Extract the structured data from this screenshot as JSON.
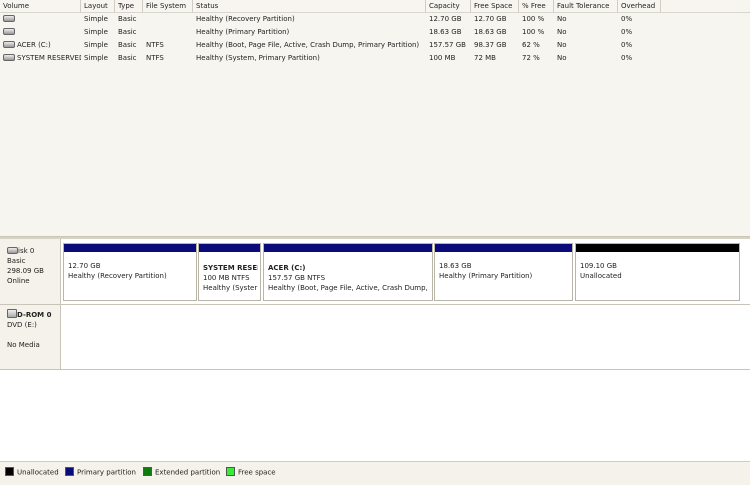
{
  "columns": [
    "Volume",
    "Layout",
    "Type",
    "File System",
    "Status",
    "Capacity",
    "Free Space",
    "% Free",
    "Fault Tolerance",
    "Overhead"
  ],
  "volumes": [
    {
      "volume": "",
      "layout": "Simple",
      "type": "Basic",
      "fs": "",
      "status": "Healthy (Recovery Partition)",
      "capacity": "12.70 GB",
      "free": "12.70 GB",
      "pct": "100 %",
      "fault": "No",
      "overhead": "0%"
    },
    {
      "volume": "",
      "layout": "Simple",
      "type": "Basic",
      "fs": "",
      "status": "Healthy (Primary Partition)",
      "capacity": "18.63 GB",
      "free": "18.63 GB",
      "pct": "100 %",
      "fault": "No",
      "overhead": "0%"
    },
    {
      "volume": "ACER (C:)",
      "layout": "Simple",
      "type": "Basic",
      "fs": "NTFS",
      "status": "Healthy (Boot, Page File, Active, Crash Dump, Primary Partition)",
      "capacity": "157.57 GB",
      "free": "98.37 GB",
      "pct": "62 %",
      "fault": "No",
      "overhead": "0%"
    },
    {
      "volume": "SYSTEM RESERVED",
      "layout": "Simple",
      "type": "Basic",
      "fs": "NTFS",
      "status": "Healthy (System, Primary Partition)",
      "capacity": "100 MB",
      "free": "72 MB",
      "pct": "72 %",
      "fault": "No",
      "overhead": "0%"
    }
  ],
  "disk0": {
    "name": "isk 0",
    "type": "Basic",
    "size": "298.09 GB",
    "status": "Online",
    "partitions": [
      {
        "title": "",
        "size": "12.70 GB",
        "status": "Healthy (Recovery Partition)"
      },
      {
        "title": "SYSTEM RESERV",
        "size": "100 MB NTFS",
        "status": "Healthy (Syster"
      },
      {
        "title": "ACER  (C:)",
        "size": "157.57 GB NTFS",
        "status": "Healthy (Boot, Page File, Active, Crash Dump,"
      },
      {
        "title": "",
        "size": "18.63 GB",
        "status": "Healthy (Primary Partition)"
      },
      {
        "title": "",
        "size": "109.10 GB",
        "status": "Unallocated"
      }
    ]
  },
  "cdrom0": {
    "name": "D-ROM 0",
    "type": "DVD (E:)",
    "status": "No Media"
  },
  "legend": [
    {
      "label": "Unallocated",
      "color": "#000000"
    },
    {
      "label": "Primary partition",
      "color": "#0a0a78"
    },
    {
      "label": "Extended partition",
      "color": "#0f7a0f"
    },
    {
      "label": "Free space",
      "color": "#33ee33"
    }
  ],
  "colors": {
    "primary": "#0a0a78",
    "unallocated": "#000000"
  }
}
